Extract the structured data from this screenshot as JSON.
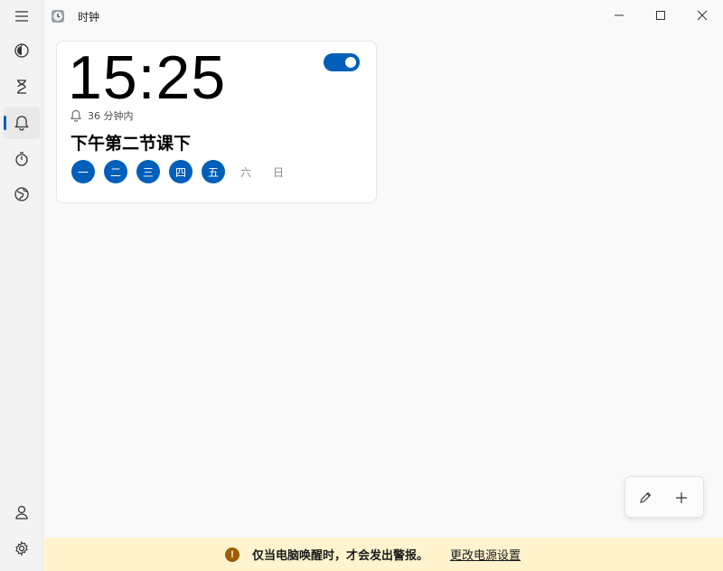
{
  "app": {
    "title": "时钟"
  },
  "nav": {
    "items": [
      {
        "icon": "hamburger-menu-icon"
      },
      {
        "icon": "focus-sessions-icon"
      },
      {
        "icon": "timer-hourglass-icon"
      },
      {
        "icon": "alarm-bell-icon",
        "active": true
      },
      {
        "icon": "stopwatch-icon"
      },
      {
        "icon": "world-clock-icon"
      },
      {
        "icon": "account-icon"
      },
      {
        "icon": "settings-gear-icon"
      }
    ]
  },
  "alarm": {
    "time": "15:25",
    "enabled": true,
    "remaining": "36 分钟内",
    "name": "下午第二节课下",
    "days": [
      {
        "label": "一",
        "on": true
      },
      {
        "label": "二",
        "on": true
      },
      {
        "label": "三",
        "on": true
      },
      {
        "label": "四",
        "on": true
      },
      {
        "label": "五",
        "on": true
      },
      {
        "label": "六",
        "on": false
      },
      {
        "label": "日",
        "on": false
      }
    ]
  },
  "infobar": {
    "icon_text": "!",
    "message": "仅当电脑唤醒时，才会发出警报。",
    "link": "更改电源设置"
  },
  "colors": {
    "accent": "#005fb8",
    "warning_bg": "#fff4ce",
    "warning_icon": "#9d5d00"
  }
}
